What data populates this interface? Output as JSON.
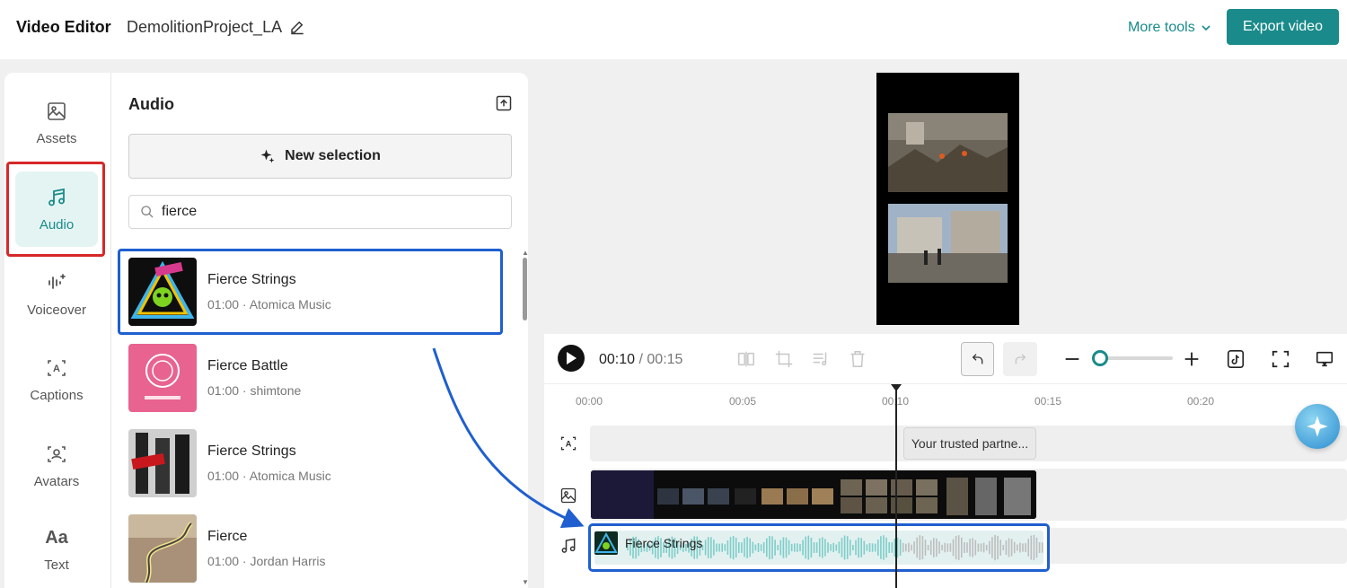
{
  "header": {
    "app_title": "Video Editor",
    "project_name": "DemolitionProject_LA",
    "more_tools_label": "More tools",
    "export_label": "Export video"
  },
  "sidenav": {
    "items": [
      {
        "label": "Assets",
        "icon": "image-icon"
      },
      {
        "label": "Audio",
        "icon": "music-note-icon",
        "active": true
      },
      {
        "label": "Voiceover",
        "icon": "voiceover-icon"
      },
      {
        "label": "Captions",
        "icon": "captions-icon"
      },
      {
        "label": "Avatars",
        "icon": "avatar-icon"
      },
      {
        "label": "Text",
        "icon": "text-icon",
        "glyph": "Aa"
      }
    ]
  },
  "audio_panel": {
    "title": "Audio",
    "new_selection_label": "New selection",
    "search": {
      "value": "fierce",
      "placeholder": ""
    },
    "tracks": [
      {
        "name": "Fierce Strings",
        "meta": "01:00 · Atomica Music",
        "selected": true
      },
      {
        "name": "Fierce Battle",
        "meta": "01:00 · shimtone"
      },
      {
        "name": "Fierce Strings",
        "meta": "01:00 · Atomica Music"
      },
      {
        "name": "Fierce",
        "meta": "01:00 · Jordan Harris"
      }
    ]
  },
  "timeline": {
    "current_time": "00:10",
    "separator": " / ",
    "total_time": "00:15",
    "ruler_labels": [
      "00:00",
      "00:05",
      "00:10",
      "00:15",
      "00:20"
    ],
    "caption_clip_text": "Your trusted partne...",
    "audio_clip_name": "Fierce Strings",
    "zoom_level": 0.0
  },
  "colors": {
    "accent": "#1a8a8a",
    "highlight_red": "#d62828",
    "highlight_blue": "#1f5fcf"
  }
}
